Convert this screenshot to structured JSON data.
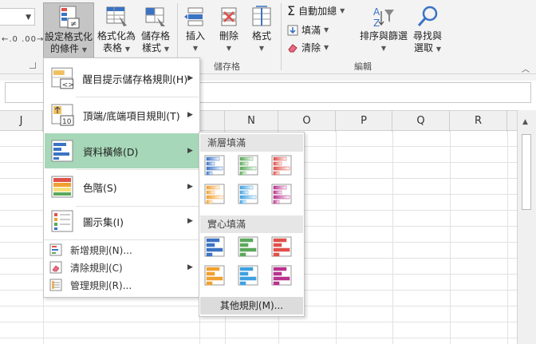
{
  "ribbon": {
    "number_format_value": "",
    "decimal_buttons": "←.0 .00→",
    "conditional_formatting": {
      "line1": "設定格式化",
      "line2": "的條件"
    },
    "format_as_table": {
      "line1": "格式化為",
      "line2": "表格"
    },
    "cell_styles": {
      "line1": "儲存格",
      "line2": "樣式"
    },
    "insert": "插入",
    "delete": "刪除",
    "format": "格式",
    "cells_group": "儲存格",
    "autosum": "自動加總",
    "fill": "填滿",
    "clear": "清除",
    "sort_filter": {
      "line1": "排序與篩選"
    },
    "find_select": {
      "line1": "尋找與",
      "line2": "選取"
    },
    "editing_group": "編輯"
  },
  "columns": [
    "J",
    "N",
    "O",
    "P",
    "Q",
    "R"
  ],
  "menu": {
    "items": [
      {
        "label": "醒目提示儲存格規則(H)"
      },
      {
        "label": "頂端/底端項目規則(T)"
      },
      {
        "label": "資料橫條(D)"
      },
      {
        "label": "色階(S)"
      },
      {
        "label": "圖示集(I)"
      }
    ],
    "small_items": [
      {
        "label": "新增規則(N)..."
      },
      {
        "label": "清除規則(C)"
      },
      {
        "label": "管理規則(R)..."
      }
    ]
  },
  "submenu": {
    "gradient_header": "漸層填滿",
    "solid_header": "實心填滿",
    "more_rules": "其他規則(M)...",
    "bar_colors": [
      "#3b73c4",
      "#5ba85b",
      "#e0504a",
      "#f0a030",
      "#3fa0e0",
      "#b8338f"
    ]
  },
  "colors": {
    "highlight": "#a6d7b8",
    "ribbon_bg": "#f3f3f3"
  }
}
